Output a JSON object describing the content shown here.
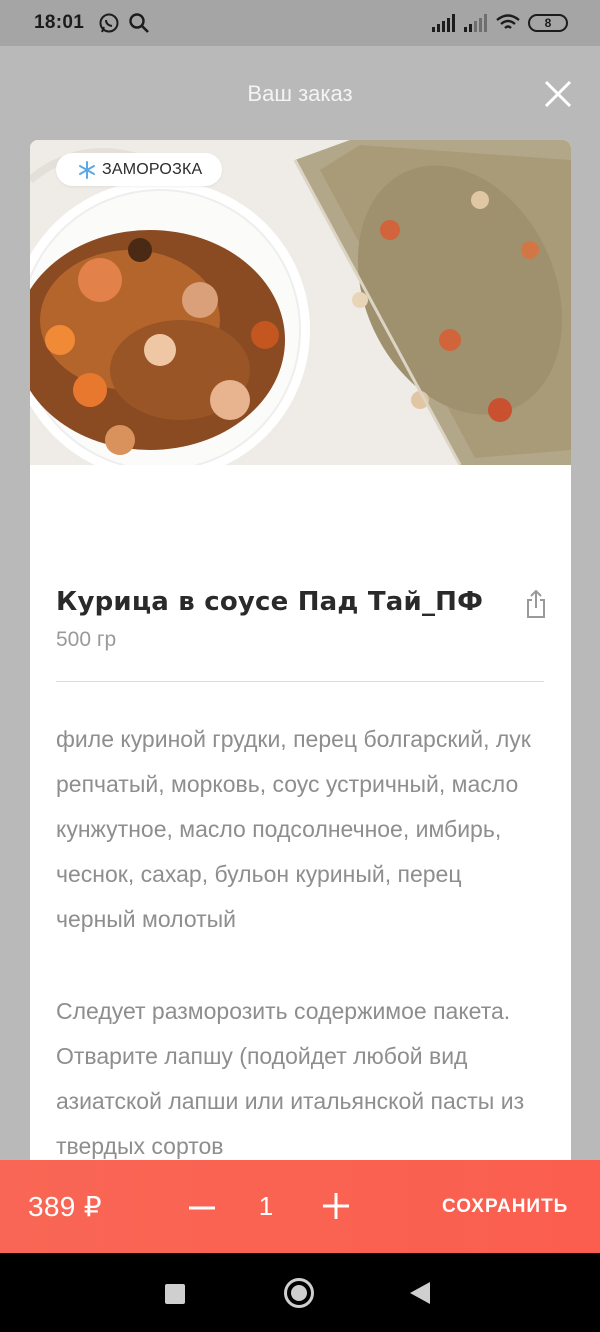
{
  "status_bar": {
    "time": "18:01",
    "battery": "8"
  },
  "header": {
    "title": "Ваш заказ"
  },
  "product": {
    "badge": "ЗАМОРОЗКА",
    "name": "Курица в соусе Пад Тай_ПФ",
    "weight": "500 гр",
    "ingredients": "филе куриной грудки, перец болгарский, лук репчатый, морковь, соус устричный, масло кунжутное, масло подсолнечное, имбирь, чеснок, сахар, бульон куриный, перец черный молотый",
    "instructions": "Следует разморозить содержимое пакета. Отварите лапшу (подойдет любой вид азиатской лапши или итальянской пасты из твердых сортов"
  },
  "action_bar": {
    "price": "389 ₽",
    "quantity": "1",
    "save_label": "СОХРАНИТЬ"
  },
  "colors": {
    "accent": "#fa6252",
    "overlay": "#b9b9b9",
    "text_secondary": "#8e8e8e"
  },
  "icons": {
    "badge": "snowflake-icon",
    "close": "close-icon",
    "share": "share-icon",
    "minus": "minus-icon",
    "plus": "plus-icon"
  }
}
